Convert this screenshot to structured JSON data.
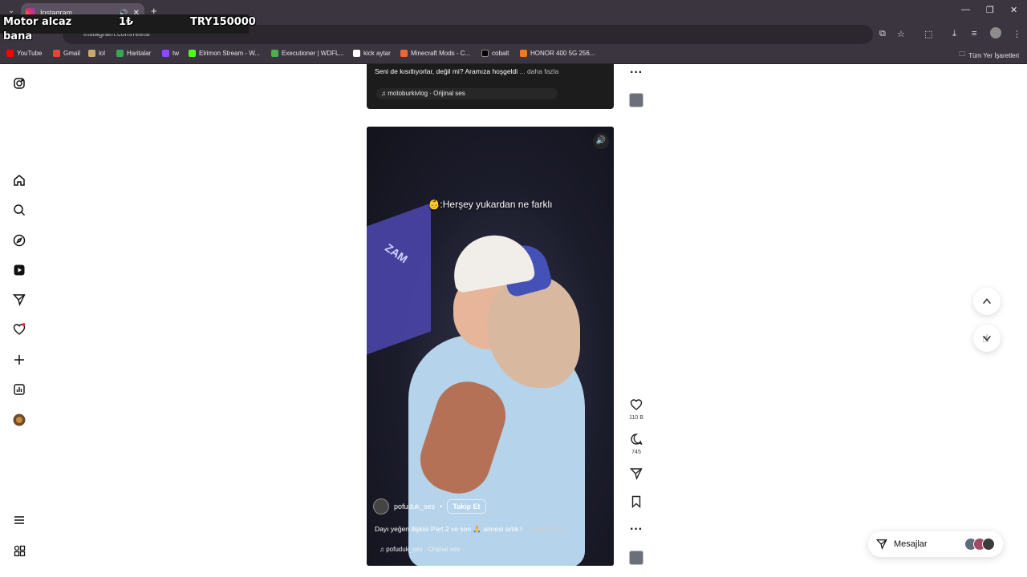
{
  "browser": {
    "tab_title": "Instagram",
    "tab_audio_icon": "speaker-icon",
    "new_tab": "+",
    "window_controls": [
      "minimize-icon",
      "restore-icon",
      "close-icon"
    ],
    "address_text": "instagram.com/reels/"
  },
  "overlay": {
    "line1": "Motor alcaz",
    "amount_symbol": "1₺",
    "amount": "TRY150000",
    "line2": "bana"
  },
  "bookmarks": {
    "items": [
      {
        "label": "YouTube",
        "color": "#ff0000"
      },
      {
        "label": "Gmail",
        "color": "#ea4335"
      },
      {
        "label": "lol",
        "color": "#c8aa6e"
      },
      {
        "label": "Haritalar",
        "color": "#34a853"
      },
      {
        "label": "tw",
        "color": "#9146ff"
      },
      {
        "label": "Elrimon Stream - W...",
        "color": "#53fc18"
      },
      {
        "label": "Executioner | WDFL...",
        "color": "#4caf50"
      },
      {
        "label": "kick aytar",
        "color": "#ffffff"
      },
      {
        "label": "Minecraft Mods - C...",
        "color": "#f16436"
      },
      {
        "label": "cobalt",
        "color": "#000000"
      },
      {
        "label": "HONOR 400 5G 256...",
        "color": "#f27a1a"
      }
    ],
    "all_label": "Tüm Yer İşaretleri"
  },
  "sidebar": {
    "items": [
      "instagram-logo-icon",
      "home-icon",
      "search-icon",
      "explore-icon",
      "reels-icon",
      "messages-icon",
      "notifications-icon",
      "create-icon",
      "dashboard-icon",
      "profile-avatar",
      "more-menu-icon",
      "meta-apps-icon"
    ]
  },
  "previous_post": {
    "caption": "Seni de kısıtlıyorlar, değil mi? Aramıza hoşgeldi",
    "more": "... daha fazla",
    "audio": "motoburkivlog · Orijinal ses"
  },
  "reel": {
    "title": "👶:Herşey yukardan ne farklı",
    "username": "pofuduk_ses",
    "dot": "•",
    "follow": "Takip Et",
    "caption": "Dayı yeğen ilişkisi Part 2 ve son 🙏 annesi artık l",
    "more": "... daha fazla",
    "audio": "pofuduk_ses · Orijinal ses"
  },
  "actions": {
    "likes": "110 B",
    "comments": "745"
  },
  "messages": {
    "label": "Mesajlar",
    "avatar_colors": [
      "#5d6b7a",
      "#a04a6a",
      "#3b3b3b"
    ]
  },
  "colors": {
    "chrome_bg": "#3b3540",
    "accent_notification": "#ff3040"
  }
}
